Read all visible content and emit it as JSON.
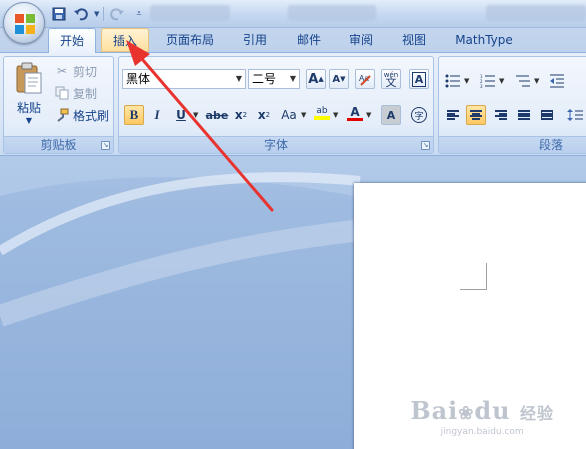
{
  "quick_access": {
    "save_icon": "save-icon",
    "undo_icon": "undo-icon",
    "redo_icon": "redo-icon",
    "customize_icon": "customize-icon"
  },
  "tabs": [
    {
      "label": "开始",
      "state": "active"
    },
    {
      "label": "插入",
      "state": "hover"
    },
    {
      "label": "页面布局",
      "state": "normal"
    },
    {
      "label": "引用",
      "state": "normal"
    },
    {
      "label": "邮件",
      "state": "normal"
    },
    {
      "label": "审阅",
      "state": "normal"
    },
    {
      "label": "视图",
      "state": "normal"
    },
    {
      "label": "MathType",
      "state": "normal"
    }
  ],
  "clipboard": {
    "paste_label": "粘贴",
    "cut_label": "剪切",
    "copy_label": "复制",
    "format_painter_label": "格式刷",
    "group_label": "剪贴板"
  },
  "font": {
    "font_name": "黑体",
    "font_size": "二号",
    "grow_glyph": "A",
    "shrink_glyph": "A",
    "phonetic_glyph": "文",
    "clear_format_glyph": "wén",
    "char_border_glyph": "A",
    "bold_glyph": "B",
    "italic_glyph": "I",
    "underline_glyph": "U",
    "strike_glyph": "abe",
    "subscript_glyph": "x",
    "subscript_mark": "2",
    "superscript_glyph": "x",
    "superscript_mark": "2",
    "case_glyph": "Aa",
    "highlight_glyph": "ab",
    "font_color_glyph": "A",
    "char_shading_glyph": "A",
    "enclose_glyph": "字",
    "group_label": "字体",
    "highlight_color": "#ffff00",
    "font_color": "#e00000"
  },
  "paragraph": {
    "group_label": "段落"
  },
  "colors": {
    "accent": "#15428b",
    "annotation_arrow": "#e8332e",
    "active_tab": "#ffffff",
    "hover_tab": "#ffe0a0"
  },
  "watermark": {
    "brand": "Bai",
    "paw": "du",
    "suffix": "经验",
    "url": "jingyan.baidu.com"
  }
}
